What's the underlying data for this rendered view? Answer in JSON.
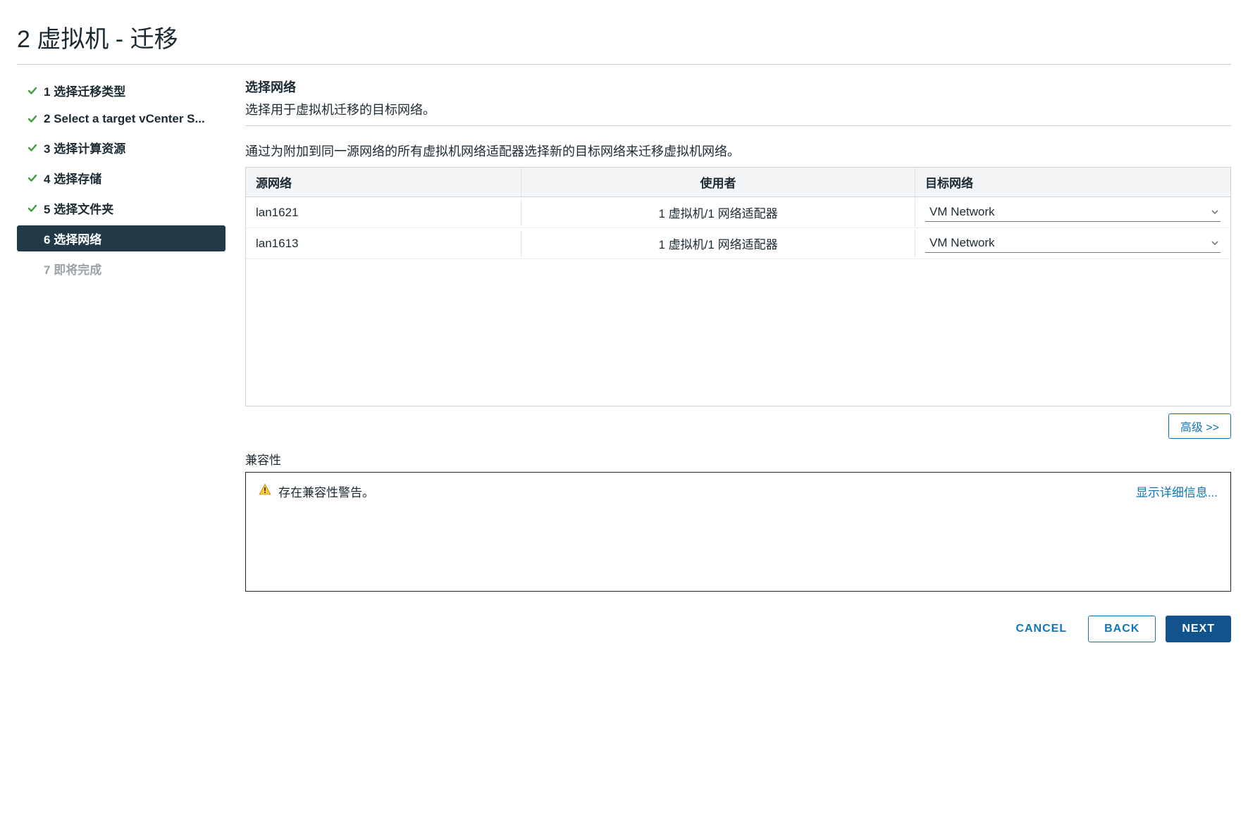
{
  "dialog": {
    "title": "2 虚拟机 - 迁移"
  },
  "steps": [
    {
      "num": "1",
      "label": "选择迁移类型",
      "state": "done"
    },
    {
      "num": "2",
      "label": "Select a target vCenter S...",
      "state": "done"
    },
    {
      "num": "3",
      "label": "选择计算资源",
      "state": "done"
    },
    {
      "num": "4",
      "label": "选择存储",
      "state": "done"
    },
    {
      "num": "5",
      "label": "选择文件夹",
      "state": "done"
    },
    {
      "num": "6",
      "label": "选择网络",
      "state": "active"
    },
    {
      "num": "7",
      "label": "即将完成",
      "state": "pending"
    }
  ],
  "section": {
    "title": "选择网络",
    "description": "选择用于虚拟机迁移的目标网络。",
    "instruction": "通过为附加到同一源网络的所有虚拟机网络适配器选择新的目标网络来迁移虚拟机网络。"
  },
  "table": {
    "headers": {
      "source": "源网络",
      "usedBy": "使用者",
      "destination": "目标网络"
    },
    "rows": [
      {
        "source": "lan1621",
        "usedBy": "1 虚拟机/1 网络适配器",
        "destination": "VM Network"
      },
      {
        "source": "lan1613",
        "usedBy": "1 虚拟机/1 网络适配器",
        "destination": "VM Network"
      }
    ]
  },
  "advanced_label": "高级 >>",
  "compatibility": {
    "label": "兼容性",
    "warning_text": "存在兼容性警告。",
    "details_link": "显示详细信息..."
  },
  "footer": {
    "cancel": "CANCEL",
    "back": "BACK",
    "next": "NEXT"
  }
}
